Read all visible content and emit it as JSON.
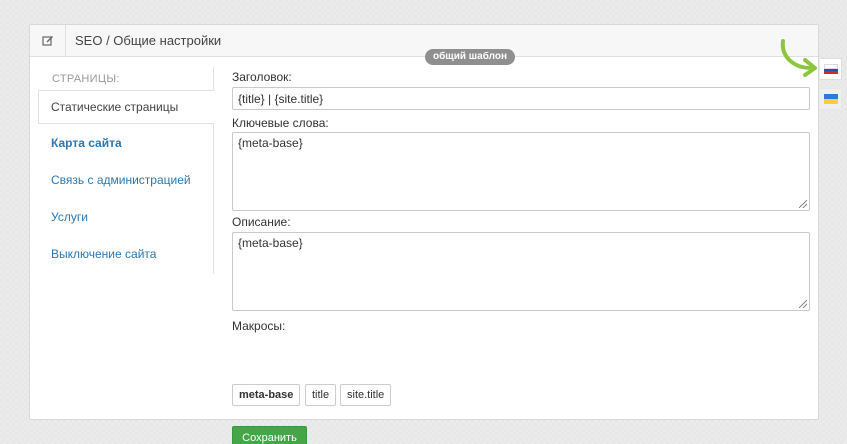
{
  "header": {
    "title": "SEO / Общие настройки",
    "edit_icon": "edit-icon",
    "badge": "общий шаблон"
  },
  "sidebar": {
    "heading": "СТРАНИЦЫ:",
    "items": [
      {
        "label": "Статические страницы",
        "active": true
      },
      {
        "label": "Карта сайта",
        "bold": true
      },
      {
        "label": "Связь с администрацией"
      },
      {
        "label": "Услуги"
      },
      {
        "label": "Выключение сайта"
      }
    ]
  },
  "form": {
    "title_label": "Заголовок:",
    "title_value": "{title} | {site.title}",
    "keywords_label": "Ключевые слова:",
    "keywords_value": "{meta-base}",
    "description_label": "Описание:",
    "description_value": "{meta-base}",
    "macros_label": "Макросы:",
    "macros": [
      "meta-base",
      "title",
      "site.title"
    ],
    "save_label": "Сохранить"
  },
  "languages": [
    {
      "code": "ru",
      "icon": "russian-flag-icon",
      "active": true,
      "colors": [
        "#ffffff",
        "#1b4fc4",
        "#d52b1e"
      ]
    },
    {
      "code": "uk",
      "icon": "ukrainian-flag-icon",
      "active": false,
      "colors": [
        "#2f7ad6",
        "#f4d03f"
      ]
    }
  ],
  "colors": {
    "accent_link": "#2a78b4",
    "save_button": "#43a747",
    "arrow": "#8cc63e",
    "badge": "#8f8f8f"
  }
}
